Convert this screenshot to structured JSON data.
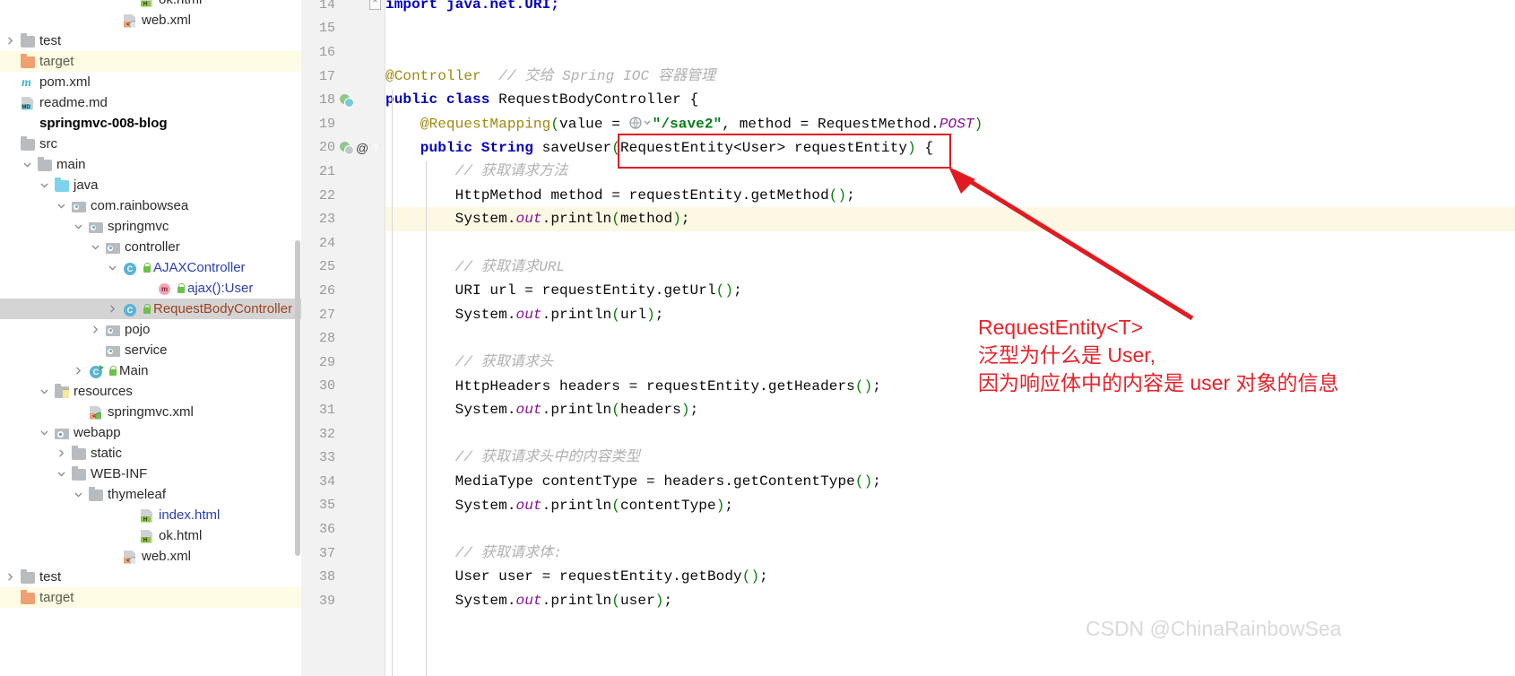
{
  "sidebar": {
    "items": [
      {
        "indent": 7,
        "arrow": "none",
        "icon": "html-file-icon",
        "label": "ok.html",
        "style": "plain",
        "row": "none"
      },
      {
        "indent": 6,
        "arrow": "none",
        "icon": "xml-file-icon",
        "label": "web.xml",
        "style": "plain",
        "row": "none"
      },
      {
        "indent": 0,
        "arrow": "collapsed",
        "icon": "folder-icon",
        "label": "test",
        "style": "plain",
        "row": "none"
      },
      {
        "indent": 0,
        "arrow": "none",
        "icon": "folder-orange-icon",
        "label": "target",
        "style": "grey",
        "row": "yellow"
      },
      {
        "indent": 0,
        "arrow": "none",
        "icon": "maven-icon",
        "label": "pom.xml",
        "style": "plain",
        "row": "none"
      },
      {
        "indent": 0,
        "arrow": "none",
        "icon": "markdown-file-icon",
        "label": "readme.md",
        "style": "plain",
        "row": "none"
      },
      {
        "indent": 0,
        "arrow": "none",
        "icon": "module-icon",
        "label": "springmvc-008-blog",
        "style": "bold",
        "row": "none"
      },
      {
        "indent": 0,
        "arrow": "none",
        "icon": "folder-icon",
        "label": "src",
        "style": "plain",
        "row": "none"
      },
      {
        "indent": 1,
        "arrow": "expanded",
        "icon": "folder-icon",
        "label": "main",
        "style": "plain",
        "row": "none"
      },
      {
        "indent": 2,
        "arrow": "expanded",
        "icon": "folder-blue-icon",
        "label": "java",
        "style": "plain",
        "row": "none"
      },
      {
        "indent": 3,
        "arrow": "expanded",
        "icon": "package-icon",
        "label": "com.rainbowsea",
        "style": "plain",
        "row": "none"
      },
      {
        "indent": 4,
        "arrow": "expanded",
        "icon": "package-icon",
        "label": "springmvc",
        "style": "plain",
        "row": "none"
      },
      {
        "indent": 5,
        "arrow": "expanded",
        "icon": "package-icon",
        "label": "controller",
        "style": "plain",
        "row": "none"
      },
      {
        "indent": 6,
        "arrow": "expanded",
        "icon": "class-icon",
        "label": "AJAXController",
        "style": "blue",
        "row": "none",
        "lock": true
      },
      {
        "indent": 8,
        "arrow": "none",
        "icon": "method-icon",
        "label": "ajax():User",
        "style": "blue",
        "row": "none",
        "lock": true
      },
      {
        "indent": 6,
        "arrow": "collapsed",
        "icon": "class-icon",
        "label": "RequestBodyController",
        "style": "brown",
        "row": "grey",
        "lock": true
      },
      {
        "indent": 5,
        "arrow": "collapsed",
        "icon": "package-icon",
        "label": "pojo",
        "style": "plain",
        "row": "none"
      },
      {
        "indent": 5,
        "arrow": "none",
        "icon": "package-icon",
        "label": "service",
        "style": "plain",
        "row": "none"
      },
      {
        "indent": 4,
        "arrow": "collapsed",
        "icon": "class-runnable-icon",
        "label": "Main",
        "style": "plain",
        "row": "none",
        "lock": true
      },
      {
        "indent": 2,
        "arrow": "expanded",
        "icon": "resources-folder-icon",
        "label": "resources",
        "style": "plain",
        "row": "none"
      },
      {
        "indent": 4,
        "arrow": "none",
        "icon": "spring-xml-icon",
        "label": "springmvc.xml",
        "style": "plain",
        "row": "none"
      },
      {
        "indent": 2,
        "arrow": "expanded",
        "icon": "webapp-icon",
        "label": "webapp",
        "style": "plain",
        "row": "none"
      },
      {
        "indent": 3,
        "arrow": "collapsed",
        "icon": "folder-icon",
        "label": "static",
        "style": "plain",
        "row": "none"
      },
      {
        "indent": 3,
        "arrow": "expanded",
        "icon": "folder-icon",
        "label": "WEB-INF",
        "style": "plain",
        "row": "none"
      },
      {
        "indent": 4,
        "arrow": "expanded",
        "icon": "folder-icon",
        "label": "thymeleaf",
        "style": "plain",
        "row": "none"
      },
      {
        "indent": 7,
        "arrow": "none",
        "icon": "html-file-icon",
        "label": "index.html",
        "style": "blue",
        "row": "none"
      },
      {
        "indent": 7,
        "arrow": "none",
        "icon": "html-file-icon",
        "label": "ok.html",
        "style": "plain",
        "row": "none"
      },
      {
        "indent": 6,
        "arrow": "none",
        "icon": "xml-file-icon",
        "label": "web.xml",
        "style": "plain",
        "row": "none"
      },
      {
        "indent": 0,
        "arrow": "collapsed",
        "icon": "folder-icon",
        "label": "test",
        "style": "plain",
        "row": "none"
      },
      {
        "indent": 0,
        "arrow": "none",
        "icon": "folder-orange-icon",
        "label": "target",
        "style": "grey",
        "row": "yellow"
      }
    ]
  },
  "editor": {
    "lines": [
      {
        "num": "14",
        "icons": [],
        "fold": "top",
        "highlight": false,
        "tokens": [
          {
            "t": "import java.net.URI;",
            "c": "kw"
          }
        ]
      },
      {
        "num": "15",
        "icons": [],
        "fold": "",
        "highlight": false,
        "tokens": []
      },
      {
        "num": "16",
        "icons": [],
        "fold": "",
        "highlight": false,
        "tokens": []
      },
      {
        "num": "17",
        "icons": [],
        "fold": "",
        "highlight": false,
        "tokens": [
          {
            "t": "@Controller",
            "c": "anno"
          },
          {
            "t": "  // 交给 Spring IOC 容器管理",
            "c": "cmt"
          }
        ]
      },
      {
        "num": "18",
        "icons": [
          "spring-bean-icon"
        ],
        "fold": "",
        "highlight": false,
        "tokens": [
          {
            "t": "public class ",
            "c": "kw"
          },
          {
            "t": "RequestBodyController ",
            "c": ""
          },
          {
            "t": "{",
            "c": ""
          }
        ]
      },
      {
        "num": "19",
        "icons": [],
        "fold": "",
        "highlight": false,
        "tokens": [
          {
            "t": "    @RequestMapping",
            "c": "anno"
          },
          {
            "t": "(",
            "c": "paren"
          },
          {
            "t": "value = ",
            "c": ""
          },
          {
            "t": "@ICON@",
            "c": "url-icon"
          },
          {
            "t": "\"/save2\"",
            "c": "str"
          },
          {
            "t": ", method = RequestMethod.",
            "c": ""
          },
          {
            "t": "POST",
            "c": "field"
          },
          {
            "t": ")",
            "c": "paren"
          }
        ]
      },
      {
        "num": "20",
        "icons": [
          "spring-bean-globe-icon",
          "at-icon"
        ],
        "fold": "tri",
        "highlight": false,
        "tokens": [
          {
            "t": "    public String ",
            "c": "kw"
          },
          {
            "t": "saveUser",
            "c": ""
          },
          {
            "t": "(",
            "c": "paren"
          },
          {
            "t": "RequestEntity<User> requestEntity",
            "c": ""
          },
          {
            "t": ")",
            "c": "paren"
          },
          {
            "t": " {",
            "c": ""
          }
        ]
      },
      {
        "num": "21",
        "icons": [],
        "fold": "",
        "highlight": false,
        "tokens": [
          {
            "t": "        // 获取请求方法",
            "c": "cmt"
          }
        ]
      },
      {
        "num": "22",
        "icons": [],
        "fold": "",
        "highlight": false,
        "tokens": [
          {
            "t": "        HttpMethod method = requestEntity.getMethod",
            "c": ""
          },
          {
            "t": "()",
            "c": "paren"
          },
          {
            "t": ";",
            "c": ""
          }
        ]
      },
      {
        "num": "23",
        "icons": [],
        "fold": "",
        "highlight": true,
        "tokens": [
          {
            "t": "        System.",
            "c": ""
          },
          {
            "t": "out",
            "c": "field"
          },
          {
            "t": ".println",
            "c": ""
          },
          {
            "t": "(",
            "c": "paren"
          },
          {
            "t": "method",
            "c": ""
          },
          {
            "t": ")",
            "c": "paren"
          },
          {
            "t": ";",
            "c": ""
          }
        ]
      },
      {
        "num": "24",
        "icons": [],
        "fold": "",
        "highlight": false,
        "tokens": []
      },
      {
        "num": "25",
        "icons": [],
        "fold": "",
        "highlight": false,
        "tokens": [
          {
            "t": "        // 获取请求URL",
            "c": "cmt"
          }
        ]
      },
      {
        "num": "26",
        "icons": [],
        "fold": "",
        "highlight": false,
        "tokens": [
          {
            "t": "        URI url = requestEntity.getUrl",
            "c": ""
          },
          {
            "t": "()",
            "c": "paren"
          },
          {
            "t": ";",
            "c": ""
          }
        ]
      },
      {
        "num": "27",
        "icons": [],
        "fold": "",
        "highlight": false,
        "tokens": [
          {
            "t": "        System.",
            "c": ""
          },
          {
            "t": "out",
            "c": "field"
          },
          {
            "t": ".println",
            "c": ""
          },
          {
            "t": "(",
            "c": "paren"
          },
          {
            "t": "url",
            "c": ""
          },
          {
            "t": ")",
            "c": "paren"
          },
          {
            "t": ";",
            "c": ""
          }
        ]
      },
      {
        "num": "28",
        "icons": [],
        "fold": "",
        "highlight": false,
        "tokens": []
      },
      {
        "num": "29",
        "icons": [],
        "fold": "",
        "highlight": false,
        "tokens": [
          {
            "t": "        // 获取请求头",
            "c": "cmt"
          }
        ]
      },
      {
        "num": "30",
        "icons": [],
        "fold": "",
        "highlight": false,
        "tokens": [
          {
            "t": "        HttpHeaders headers = requestEntity.getHeaders",
            "c": ""
          },
          {
            "t": "()",
            "c": "paren"
          },
          {
            "t": ";",
            "c": ""
          }
        ]
      },
      {
        "num": "31",
        "icons": [],
        "fold": "",
        "highlight": false,
        "tokens": [
          {
            "t": "        System.",
            "c": ""
          },
          {
            "t": "out",
            "c": "field"
          },
          {
            "t": ".println",
            "c": ""
          },
          {
            "t": "(",
            "c": "paren"
          },
          {
            "t": "headers",
            "c": ""
          },
          {
            "t": ")",
            "c": "paren"
          },
          {
            "t": ";",
            "c": ""
          }
        ]
      },
      {
        "num": "32",
        "icons": [],
        "fold": "",
        "highlight": false,
        "tokens": []
      },
      {
        "num": "33",
        "icons": [],
        "fold": "",
        "highlight": false,
        "tokens": [
          {
            "t": "        // 获取请求头中的内容类型",
            "c": "cmt"
          }
        ]
      },
      {
        "num": "34",
        "icons": [],
        "fold": "",
        "highlight": false,
        "tokens": [
          {
            "t": "        MediaType contentType = headers.getContentType",
            "c": ""
          },
          {
            "t": "()",
            "c": "paren"
          },
          {
            "t": ";",
            "c": ""
          }
        ]
      },
      {
        "num": "35",
        "icons": [],
        "fold": "",
        "highlight": false,
        "tokens": [
          {
            "t": "        System.",
            "c": ""
          },
          {
            "t": "out",
            "c": "field"
          },
          {
            "t": ".println",
            "c": ""
          },
          {
            "t": "(",
            "c": "paren"
          },
          {
            "t": "contentType",
            "c": ""
          },
          {
            "t": ")",
            "c": "paren"
          },
          {
            "t": ";",
            "c": ""
          }
        ]
      },
      {
        "num": "36",
        "icons": [],
        "fold": "",
        "highlight": false,
        "tokens": []
      },
      {
        "num": "37",
        "icons": [],
        "fold": "",
        "highlight": false,
        "tokens": [
          {
            "t": "        // 获取请求体:",
            "c": "cmt"
          }
        ]
      },
      {
        "num": "38",
        "icons": [],
        "fold": "",
        "highlight": false,
        "tokens": [
          {
            "t": "        User user = requestEntity.getBody",
            "c": ""
          },
          {
            "t": "()",
            "c": "paren"
          },
          {
            "t": ";",
            "c": ""
          }
        ]
      },
      {
        "num": "39",
        "icons": [],
        "fold": "",
        "highlight": false,
        "tokens": [
          {
            "t": "        System.",
            "c": ""
          },
          {
            "t": "out",
            "c": "field"
          },
          {
            "t": ".println",
            "c": ""
          },
          {
            "t": "(",
            "c": "paren"
          },
          {
            "t": "user",
            "c": ""
          },
          {
            "t": ")",
            "c": "paren"
          },
          {
            "t": ";",
            "c": ""
          }
        ]
      }
    ]
  },
  "annotation": {
    "line1": "RequestEntity<T>",
    "line2": "泛型为什么是 User,",
    "line3": "因为响应体中的内容是 user 对象的信息",
    "color": "#e8222a"
  },
  "watermark": {
    "text": "CSDN @ChinaRainbowSea"
  }
}
